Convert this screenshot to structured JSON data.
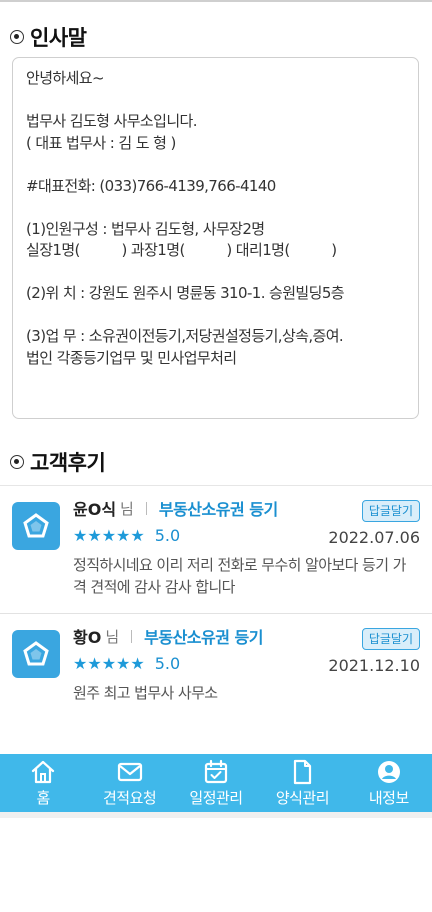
{
  "greeting": {
    "title": "인사말",
    "lines": [
      "안녕하세요~",
      "",
      "법무사 김도형 사무소입니다.",
      "( 대표 법무사 : 김 도 형 )",
      "",
      "#대표전화: (033)766-4139,766-4140",
      "",
      "(1)인원구성 : 법무사 김도형, 사무장2명",
      "실장1명(          ) 과장1명(          ) 대리1명(          )",
      "",
      "(2)위 치 : 강원도 원주시 명륜동 310-1. 승원빌딩5층",
      "",
      "(3)업 무 : 소유권이전등기,저당권설정등기,상속,증여.",
      "법인 각종등기업무 및 민사업무처리"
    ]
  },
  "reviews_section": {
    "title": "고객후기",
    "reply_label": "답글달기",
    "honorific": "님",
    "items": [
      {
        "name": "윤O식",
        "service": "부동산소유권 등기",
        "rating": 5,
        "score": "5.0",
        "date": "2022.07.06",
        "text": "정직하시네요 이리 저리 전화로 무수히 알아보다 등기 가격 견적에 감사 감사 합니다"
      },
      {
        "name": "황O",
        "service": "부동산소유권 등기",
        "rating": 5,
        "score": "5.0",
        "date": "2021.12.10",
        "text": "원주 최고 법무사 사무소"
      }
    ]
  },
  "bottom_nav": {
    "items": [
      {
        "label": "홈",
        "icon": "home-icon"
      },
      {
        "label": "견적요청",
        "icon": "mail-icon"
      },
      {
        "label": "일정관리",
        "icon": "calendar-icon"
      },
      {
        "label": "양식관리",
        "icon": "document-icon"
      },
      {
        "label": "내정보",
        "icon": "user-icon"
      }
    ]
  },
  "colors": {
    "accent": "#40b8ea",
    "link": "#1a8fd0",
    "star": "#1e9ad9"
  }
}
